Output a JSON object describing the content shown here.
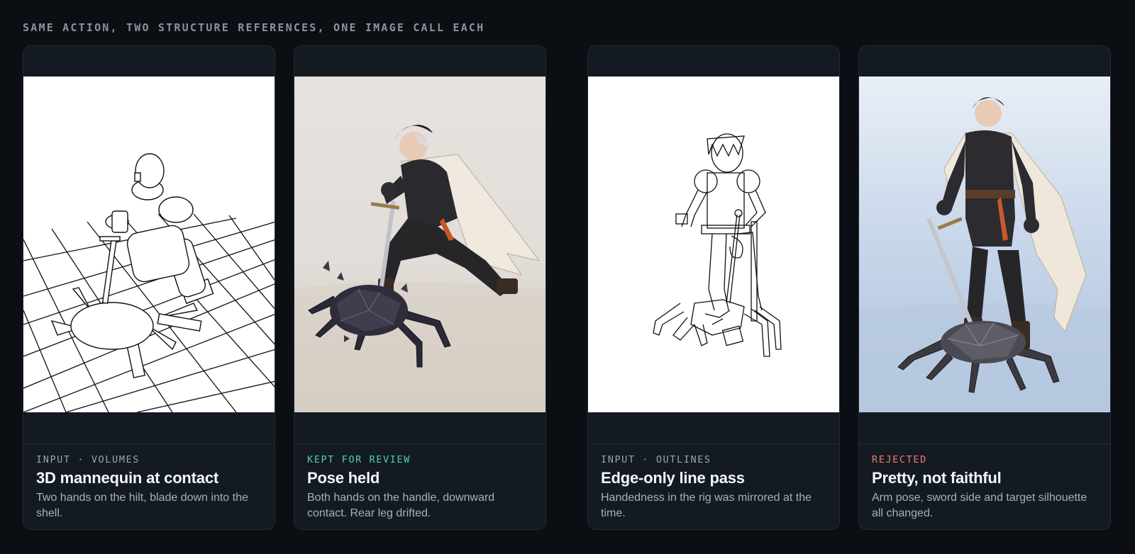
{
  "heading": "SAME ACTION, TWO STRUCTURE REFERENCES, ONE IMAGE CALL EACH",
  "colors": {
    "background": "#0b0f14",
    "card": "#141a22",
    "kept": "#4fd1a5",
    "rejected": "#f27a6e",
    "neutral_tag": "#9aa3ae"
  },
  "cards": [
    {
      "tag": "INPUT · VOLUMES",
      "tag_status": "neutral",
      "title": "3D mannequin at contact",
      "description": "Two hands on the hilt, blade down into the shell.",
      "image": "mannequin-wireframe-image"
    },
    {
      "tag": "KEPT FOR REVIEW",
      "tag_status": "kept",
      "title": "Pose held",
      "description": "Both hands on the handle, downward contact. Rear leg drifted.",
      "image": "rendered-swordsman-kneeling-image"
    },
    {
      "tag": "INPUT · OUTLINES",
      "tag_status": "neutral",
      "title": "Edge-only line pass",
      "description": "Handedness in the rig was mirrored at the time.",
      "image": "line-art-outline-image"
    },
    {
      "tag": "REJECTED",
      "tag_status": "rejected",
      "title": "Pretty, not faithful",
      "description": "Arm pose, sword side and target silhouette all changed.",
      "image": "rendered-swordsman-standing-image"
    }
  ]
}
